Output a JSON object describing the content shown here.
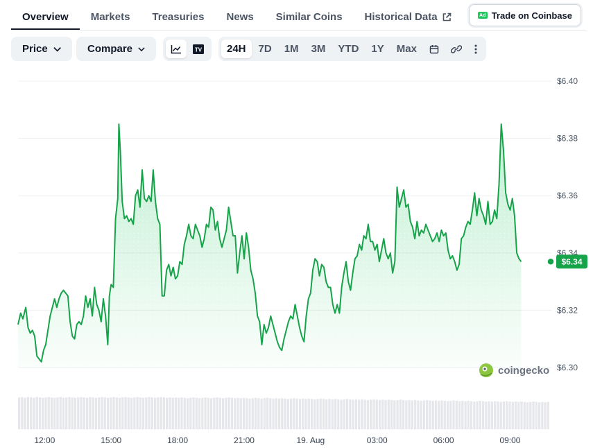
{
  "nav": {
    "tabs": [
      {
        "label": "Overview"
      },
      {
        "label": "Markets"
      },
      {
        "label": "Treasuries"
      },
      {
        "label": "News"
      },
      {
        "label": "Similar Coins"
      },
      {
        "label": "Historical Data"
      }
    ],
    "ad_badge": "Ad",
    "ad_button": "Trade on Coinbase"
  },
  "toolbar": {
    "price_dropdown": "Price",
    "compare_dropdown": "Compare",
    "chart_type_icons": [
      "line-chart-icon",
      "tradingview-icon"
    ],
    "tradingview_label": "TV",
    "ranges": [
      "24H",
      "7D",
      "1M",
      "3M",
      "YTD",
      "1Y",
      "Max"
    ],
    "active_range": "24H",
    "tool_icons": [
      "calendar-icon",
      "link-icon",
      "more-icon"
    ]
  },
  "watermark": "coingecko",
  "colors": {
    "line": "#16a34a",
    "fill": "#22c55e",
    "badge": "#16a34a",
    "volume": "#e5e7eb"
  },
  "chart_data": {
    "type": "line",
    "title": "",
    "xlabel": "",
    "ylabel": "",
    "ylim": [
      6.3,
      6.4
    ],
    "yticks": [
      "$6.40",
      "$6.38",
      "$6.36",
      "$6.34",
      "$6.32",
      "$6.30"
    ],
    "ytick_values": [
      6.4,
      6.38,
      6.36,
      6.34,
      6.32,
      6.3
    ],
    "x_range_hours": [
      0,
      24
    ],
    "xticks": [
      {
        "label": "12:00",
        "hour": 1.2
      },
      {
        "label": "15:00",
        "hour": 4.2
      },
      {
        "label": "18:00",
        "hour": 7.2
      },
      {
        "label": "21:00",
        "hour": 10.2
      },
      {
        "label": "19. Aug",
        "hour": 13.2
      },
      {
        "label": "03:00",
        "hour": 16.2
      },
      {
        "label": "06:00",
        "hour": 19.2
      },
      {
        "label": "09:00",
        "hour": 22.2
      }
    ],
    "last_price_label": "$6.34",
    "last_price": 6.337,
    "series": [
      {
        "points": [
          [
            0.0,
            6.315
          ],
          [
            0.12,
            6.319
          ],
          [
            0.22,
            6.317
          ],
          [
            0.35,
            6.321
          ],
          [
            0.45,
            6.314
          ],
          [
            0.55,
            6.312
          ],
          [
            0.65,
            6.313
          ],
          [
            0.75,
            6.311
          ],
          [
            0.85,
            6.304
          ],
          [
            0.95,
            6.303
          ],
          [
            1.05,
            6.302
          ],
          [
            1.15,
            6.306
          ],
          [
            1.25,
            6.308
          ],
          [
            1.35,
            6.313
          ],
          [
            1.45,
            6.318
          ],
          [
            1.55,
            6.321
          ],
          [
            1.65,
            6.324
          ],
          [
            1.75,
            6.321
          ],
          [
            1.85,
            6.324
          ],
          [
            1.95,
            6.326
          ],
          [
            2.05,
            6.327
          ],
          [
            2.15,
            6.326
          ],
          [
            2.25,
            6.325
          ],
          [
            2.35,
            6.316
          ],
          [
            2.45,
            6.311
          ],
          [
            2.55,
            6.31
          ],
          [
            2.65,
            6.315
          ],
          [
            2.75,
            6.316
          ],
          [
            2.85,
            6.315
          ],
          [
            2.95,
            6.318
          ],
          [
            3.05,
            6.325
          ],
          [
            3.15,
            6.321
          ],
          [
            3.25,
            6.324
          ],
          [
            3.35,
            6.318
          ],
          [
            3.45,
            6.328
          ],
          [
            3.55,
            6.322
          ],
          [
            3.65,
            6.32
          ],
          [
            3.75,
            6.316
          ],
          [
            3.85,
            6.324
          ],
          [
            3.95,
            6.318
          ],
          [
            4.05,
            6.308
          ],
          [
            4.12,
            6.325
          ],
          [
            4.2,
            6.329
          ],
          [
            4.3,
            6.328
          ],
          [
            4.4,
            6.352
          ],
          [
            4.5,
            6.359
          ],
          [
            4.55,
            6.385
          ],
          [
            4.62,
            6.375
          ],
          [
            4.7,
            6.358
          ],
          [
            4.8,
            6.352
          ],
          [
            4.9,
            6.353
          ],
          [
            5.0,
            6.351
          ],
          [
            5.1,
            6.352
          ],
          [
            5.2,
            6.35
          ],
          [
            5.3,
            6.36
          ],
          [
            5.4,
            6.362
          ],
          [
            5.5,
            6.356
          ],
          [
            5.6,
            6.369
          ],
          [
            5.7,
            6.359
          ],
          [
            5.8,
            6.358
          ],
          [
            5.9,
            6.36
          ],
          [
            6.0,
            6.358
          ],
          [
            6.1,
            6.369
          ],
          [
            6.2,
            6.358
          ],
          [
            6.3,
            6.352
          ],
          [
            6.4,
            6.35
          ],
          [
            6.5,
            6.325
          ],
          [
            6.6,
            6.325
          ],
          [
            6.7,
            6.334
          ],
          [
            6.8,
            6.336
          ],
          [
            6.9,
            6.332
          ],
          [
            7.0,
            6.335
          ],
          [
            7.1,
            6.331
          ],
          [
            7.2,
            6.332
          ],
          [
            7.3,
            6.337
          ],
          [
            7.4,
            6.336
          ],
          [
            7.5,
            6.343
          ],
          [
            7.6,
            6.346
          ],
          [
            7.7,
            6.35
          ],
          [
            7.8,
            6.346
          ],
          [
            7.9,
            6.345
          ],
          [
            8.0,
            6.35
          ],
          [
            8.1,
            6.348
          ],
          [
            8.2,
            6.346
          ],
          [
            8.3,
            6.342
          ],
          [
            8.4,
            6.345
          ],
          [
            8.5,
            6.35
          ],
          [
            8.6,
            6.349
          ],
          [
            8.7,
            6.356
          ],
          [
            8.8,
            6.355
          ],
          [
            8.9,
            6.348
          ],
          [
            9.0,
            6.351
          ],
          [
            9.1,
            6.345
          ],
          [
            9.2,
            6.342
          ],
          [
            9.3,
            6.345
          ],
          [
            9.4,
            6.348
          ],
          [
            9.5,
            6.356
          ],
          [
            9.6,
            6.351
          ],
          [
            9.7,
            6.346
          ],
          [
            9.8,
            6.346
          ],
          [
            9.9,
            6.333
          ],
          [
            10.0,
            6.34
          ],
          [
            10.1,
            6.346
          ],
          [
            10.2,
            6.338
          ],
          [
            10.3,
            6.347
          ],
          [
            10.4,
            6.342
          ],
          [
            10.5,
            6.334
          ],
          [
            10.6,
            6.331
          ],
          [
            10.7,
            6.326
          ],
          [
            10.8,
            6.318
          ],
          [
            10.9,
            6.316
          ],
          [
            11.0,
            6.308
          ],
          [
            11.1,
            6.315
          ],
          [
            11.2,
            6.312
          ],
          [
            11.3,
            6.314
          ],
          [
            11.4,
            6.318
          ],
          [
            11.5,
            6.315
          ],
          [
            11.6,
            6.312
          ],
          [
            11.7,
            6.309
          ],
          [
            11.8,
            6.307
          ],
          [
            11.9,
            6.306
          ],
          [
            12.0,
            6.31
          ],
          [
            12.1,
            6.313
          ],
          [
            12.2,
            6.316
          ],
          [
            12.3,
            6.318
          ],
          [
            12.4,
            6.317
          ],
          [
            12.5,
            6.322
          ],
          [
            12.6,
            6.318
          ],
          [
            12.7,
            6.314
          ],
          [
            12.8,
            6.311
          ],
          [
            12.9,
            6.309
          ],
          [
            13.0,
            6.318
          ],
          [
            13.1,
            6.324
          ],
          [
            13.2,
            6.326
          ],
          [
            13.3,
            6.334
          ],
          [
            13.4,
            6.338
          ],
          [
            13.5,
            6.337
          ],
          [
            13.6,
            6.332
          ],
          [
            13.7,
            6.336
          ],
          [
            13.8,
            6.335
          ],
          [
            13.9,
            6.33
          ],
          [
            14.0,
            6.328
          ],
          [
            14.1,
            6.328
          ],
          [
            14.2,
            6.322
          ],
          [
            14.3,
            6.319
          ],
          [
            14.4,
            6.322
          ],
          [
            14.5,
            6.319
          ],
          [
            14.6,
            6.328
          ],
          [
            14.7,
            6.333
          ],
          [
            14.8,
            6.337
          ],
          [
            14.9,
            6.33
          ],
          [
            15.0,
            6.327
          ],
          [
            15.1,
            6.333
          ],
          [
            15.2,
            6.338
          ],
          [
            15.3,
            6.339
          ],
          [
            15.4,
            6.343
          ],
          [
            15.5,
            6.341
          ],
          [
            15.6,
            6.346
          ],
          [
            15.7,
            6.345
          ],
          [
            15.8,
            6.35
          ],
          [
            15.9,
            6.344
          ],
          [
            16.0,
            6.344
          ],
          [
            16.1,
            6.341
          ],
          [
            16.2,
            6.343
          ],
          [
            16.3,
            6.337
          ],
          [
            16.4,
            6.341
          ],
          [
            16.5,
            6.345
          ],
          [
            16.6,
            6.34
          ],
          [
            16.7,
            6.338
          ],
          [
            16.8,
            6.34
          ],
          [
            16.9,
            6.333
          ],
          [
            17.0,
            6.337
          ],
          [
            17.1,
            6.363
          ],
          [
            17.2,
            6.356
          ],
          [
            17.3,
            6.359
          ],
          [
            17.4,
            6.362
          ],
          [
            17.5,
            6.356
          ],
          [
            17.6,
            6.357
          ],
          [
            17.7,
            6.351
          ],
          [
            17.8,
            6.349
          ],
          [
            17.9,
            6.345
          ],
          [
            18.0,
            6.351
          ],
          [
            18.1,
            6.346
          ],
          [
            18.2,
            6.348
          ],
          [
            18.3,
            6.347
          ],
          [
            18.4,
            6.35
          ],
          [
            18.5,
            6.348
          ],
          [
            18.6,
            6.346
          ],
          [
            18.7,
            6.344
          ],
          [
            18.8,
            6.345
          ],
          [
            18.9,
            6.347
          ],
          [
            19.0,
            6.344
          ],
          [
            19.1,
            6.348
          ],
          [
            19.2,
            6.346
          ],
          [
            19.3,
            6.347
          ],
          [
            19.4,
            6.341
          ],
          [
            19.5,
            6.338
          ],
          [
            19.6,
            6.339
          ],
          [
            19.7,
            6.337
          ],
          [
            19.8,
            6.334
          ],
          [
            19.9,
            6.336
          ],
          [
            20.0,
            6.345
          ],
          [
            20.1,
            6.346
          ],
          [
            20.2,
            6.349
          ],
          [
            20.3,
            6.351
          ],
          [
            20.4,
            6.35
          ],
          [
            20.5,
            6.355
          ],
          [
            20.6,
            6.361
          ],
          [
            20.7,
            6.353
          ],
          [
            20.8,
            6.359
          ],
          [
            20.9,
            6.355
          ],
          [
            21.0,
            6.353
          ],
          [
            21.1,
            6.35
          ],
          [
            21.2,
            6.358
          ],
          [
            21.3,
            6.35
          ],
          [
            21.4,
            6.351
          ],
          [
            21.5,
            6.355
          ],
          [
            21.6,
            6.352
          ],
          [
            21.7,
            6.364
          ],
          [
            21.8,
            6.385
          ],
          [
            21.9,
            6.376
          ],
          [
            22.0,
            6.361
          ],
          [
            22.1,
            6.357
          ],
          [
            22.2,
            6.355
          ],
          [
            22.3,
            6.359
          ],
          [
            22.4,
            6.353
          ],
          [
            22.5,
            6.34
          ],
          [
            22.6,
            6.338
          ],
          [
            22.7,
            6.337
          ]
        ]
      }
    ],
    "volume": [
      0.85,
      0.86,
      0.84,
      0.86,
      0.85,
      0.84,
      0.86,
      0.85,
      0.84,
      0.85,
      0.86,
      0.85,
      0.84,
      0.85,
      0.86,
      0.84,
      0.85,
      0.86,
      0.85,
      0.84,
      0.85,
      0.86,
      0.85,
      0.84,
      0.86,
      0.85,
      0.84,
      0.85,
      0.86,
      0.85,
      0.84,
      0.85,
      0.86,
      0.85,
      0.84,
      0.85,
      0.86,
      0.85,
      0.84,
      0.85,
      0.86,
      0.85,
      0.84,
      0.85,
      0.86,
      0.85,
      0.84,
      0.85,
      0.86,
      0.85,
      0.84,
      0.85,
      0.84,
      0.85,
      0.84,
      0.85,
      0.84,
      0.83,
      0.84,
      0.85,
      0.84,
      0.83,
      0.84,
      0.85,
      0.84,
      0.83,
      0.84,
      0.85,
      0.84,
      0.83,
      0.84,
      0.85,
      0.84,
      0.83,
      0.84,
      0.83,
      0.84,
      0.83,
      0.82,
      0.83,
      0.84,
      0.83,
      0.82,
      0.83,
      0.84,
      0.83,
      0.82,
      0.83,
      0.82,
      0.83,
      0.82,
      0.81,
      0.82,
      0.83,
      0.82,
      0.81,
      0.82,
      0.81,
      0.82,
      0.81,
      0.8,
      0.81,
      0.82,
      0.81,
      0.8,
      0.81,
      0.8,
      0.81,
      0.8,
      0.79,
      0.8,
      0.81,
      0.8,
      0.79,
      0.8,
      0.79,
      0.8,
      0.79,
      0.78,
      0.79,
      0.8,
      0.79,
      0.78,
      0.79,
      0.78,
      0.79,
      0.78,
      0.77,
      0.78,
      0.79,
      0.78,
      0.77,
      0.78,
      0.77,
      0.78,
      0.77,
      0.76,
      0.77,
      0.78,
      0.77,
      0.76,
      0.77,
      0.76,
      0.77,
      0.76,
      0.75,
      0.76,
      0.77,
      0.76,
      0.75,
      0.76,
      0.75,
      0.76,
      0.75,
      0.74,
      0.75,
      0.76,
      0.75,
      0.74,
      0.75,
      0.74,
      0.75,
      0.74,
      0.73,
      0.74,
      0.75,
      0.74,
      0.73,
      0.74,
      0.73,
      0.74,
      0.73,
      0.72,
      0.73,
      0.74,
      0.73,
      0.72,
      0.73,
      0.72,
      0.73
    ]
  }
}
